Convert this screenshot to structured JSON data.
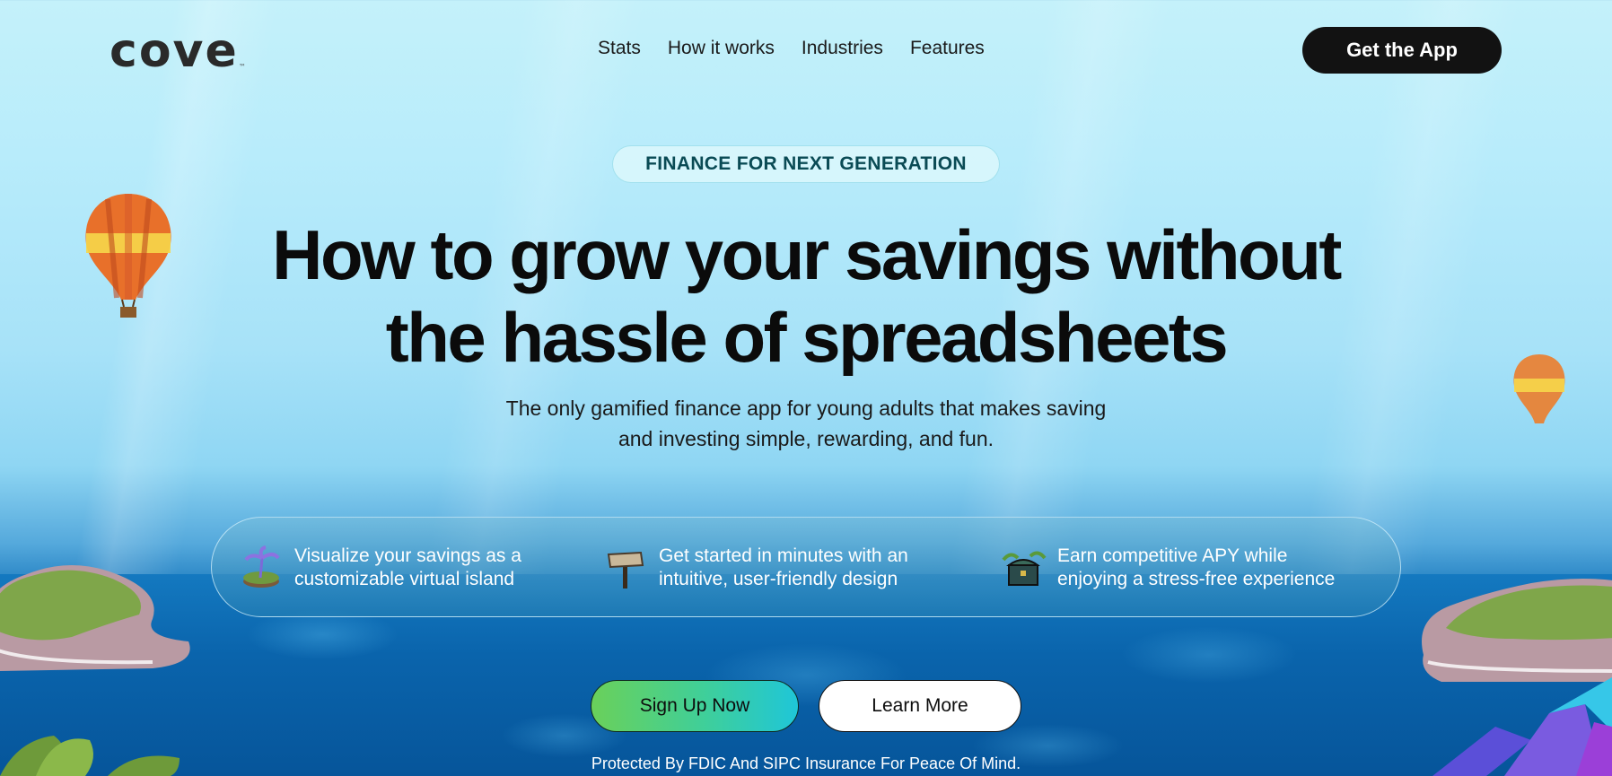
{
  "brand": {
    "logo_text": "cove",
    "tm": "™"
  },
  "nav": {
    "items": [
      "Stats",
      "How it works",
      "Industries",
      "Features"
    ]
  },
  "header": {
    "cta_label": "Get the App"
  },
  "hero": {
    "eyebrow": "FINANCE FOR NEXT GENERATION",
    "headline_line1": "How to grow your savings without",
    "headline_line2": "the hassle of spreadsheets",
    "sub_line1": "The only gamified finance app for young adults that makes saving",
    "sub_line2": "and investing simple, rewarding, and fun."
  },
  "features": [
    {
      "icon": "island-icon",
      "line1": "Visualize your savings as a",
      "line2": "customizable virtual island"
    },
    {
      "icon": "signpost-icon",
      "line1": "Get started in minutes with an",
      "line2": "intuitive, user-friendly design"
    },
    {
      "icon": "treasure-chest-icon",
      "line1": "Earn competitive APY while",
      "line2": "enjoying a stress-free experience"
    }
  ],
  "actions": {
    "signup_label": "Sign Up Now",
    "learn_label": "Learn More"
  },
  "footer_note": "Protected By FDIC And SIPC Insurance For Peace Of Mind.",
  "colors": {
    "dark": "#121212",
    "signup_gradient_start": "#6ad05a",
    "signup_gradient_end": "#1fc6d8",
    "ocean": "#0a64ac",
    "sky": "#b8ecfb"
  }
}
